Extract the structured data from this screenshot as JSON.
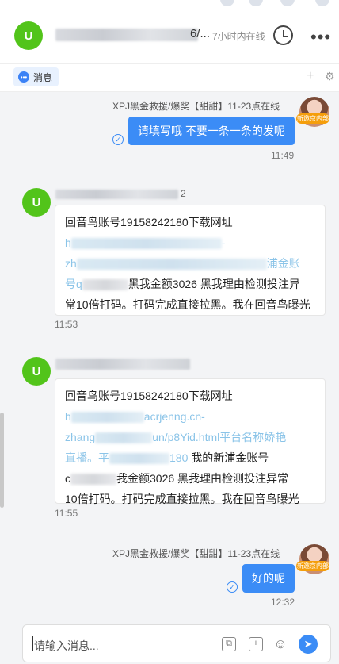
{
  "header": {
    "avatar_letter": "U",
    "title_tail": "6/...",
    "status": "7小时内在线",
    "clock_icon": "clock-icon",
    "more_icon": "more-icon"
  },
  "tabs": {
    "messages_label": "消息",
    "plus": "+",
    "gear": "⚙"
  },
  "messages": [
    {
      "sender": "XPJ黑金救援/爆奖【甜甜】11-23点在线",
      "badge": "新邀京内部",
      "text": "请填写哦 不要一条一条的发呢",
      "time": "11:49"
    },
    {
      "avatar_letter": "U",
      "name_tail": "2",
      "lines": [
        "回音鸟账号19158242180下载网址",
        "h",
        "-",
        "zh",
        "浦金账",
        "号q",
        "黑我金额3026 黑我理由检测投注异",
        "常10倍打码。打码完成直接拉黑。我在回音鸟曝光"
      ],
      "time": "11:53"
    },
    {
      "avatar_letter": "U",
      "lines": [
        "回音鸟账号19158242180下载网址",
        "h",
        "acrjenng.cn-",
        "zhang",
        "un/p8Yid.html平台名称娇艳",
        "直播。平",
        "180",
        "我的新浦金账号",
        "c",
        "我金额3026 黑我理由检测投注异常",
        "10倍打码。打码完成直接拉黑。我在回音鸟曝光"
      ],
      "time": "11:55"
    },
    {
      "sender": "XPJ黑金救援/爆奖【甜甜】11-23点在线",
      "badge": "新邀京内部",
      "text": "好的呢",
      "time": "12:32"
    }
  ],
  "composer": {
    "placeholder": "请输入消息..."
  },
  "colors": {
    "accent": "#3b8cf6",
    "avatar_green": "#52c41a",
    "badge_orange": "#f59e0b",
    "link": "#8bc4e8"
  }
}
